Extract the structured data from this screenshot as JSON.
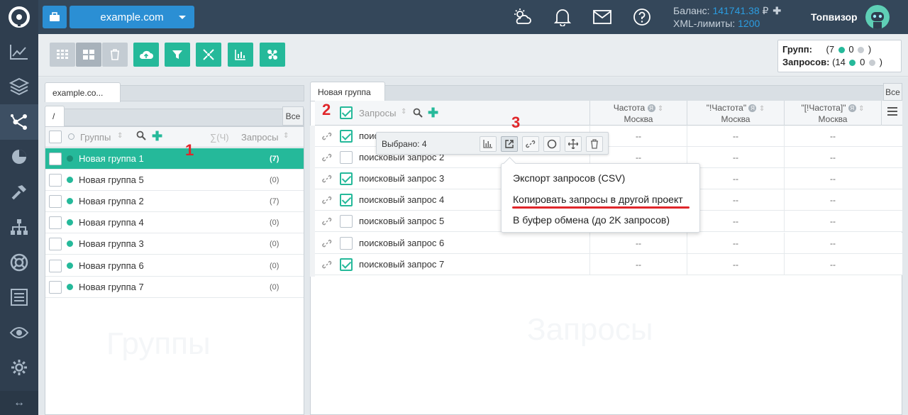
{
  "topbar": {
    "project": "example.com",
    "balance_label": "Баланс:",
    "balance_value": "141741.38",
    "currency": "₽",
    "xml_label": "XML-лимиты:",
    "xml_value": "1200",
    "username": "Топвизор"
  },
  "toolbar": {
    "stats_groups_label": "Групп:",
    "stats_groups_total": "(7",
    "stats_groups_zero": "0",
    "stats_queries_label": "Запросов:",
    "stats_queries_total": "(14",
    "stats_queries_zero": "0",
    "close_paren": ")"
  },
  "left": {
    "tab_label": "example.co...",
    "folder_tab": "/",
    "all_label": "Все",
    "header_groups": "Группы",
    "header_sum": "∑(Ч)",
    "header_queries": "Запросы",
    "watermark": "Группы",
    "groups": [
      {
        "name": "Новая группа 1",
        "count": "(7)"
      },
      {
        "name": "Новая группа 5",
        "count": "(0)"
      },
      {
        "name": "Новая группа 2",
        "count": "(7)"
      },
      {
        "name": "Новая группа 4",
        "count": "(0)"
      },
      {
        "name": "Новая группа 3",
        "count": "(0)"
      },
      {
        "name": "Новая группа 6",
        "count": "(0)"
      },
      {
        "name": "Новая группа 7",
        "count": "(0)"
      }
    ]
  },
  "right": {
    "tab_label": "Новая группа",
    "all_label": "Все",
    "header_queries": "Запросы",
    "col1_title": "Частота",
    "col2_title": "\"!Частота\"",
    "col3_title": "\"[!Частота]\"",
    "col_region": "Москва",
    "watermark": "Запросы",
    "empty_value": "--",
    "queries": [
      {
        "text": "поисковый запрос 1"
      },
      {
        "text": "поисковый запрос 2"
      },
      {
        "text": "поисковый запрос 3"
      },
      {
        "text": "поисковый запрос 4"
      },
      {
        "text": "поисковый запрос 5"
      },
      {
        "text": "поисковый запрос 6"
      },
      {
        "text": "поисковый запрос 7"
      }
    ]
  },
  "selection": {
    "label": "Выбрано: 4"
  },
  "menu": {
    "item1": "Экспорт запросов (CSV)",
    "item2": "Копировать запросы в другой проект",
    "item3": "В буфер обмена (до 2K запросов)"
  },
  "annotations": {
    "a1": "1",
    "a2": "2",
    "a3": "3"
  },
  "colors": {
    "accent": "#25b99a",
    "brand_blue": "#2b8fd4",
    "annotation_red": "#e0262a"
  }
}
